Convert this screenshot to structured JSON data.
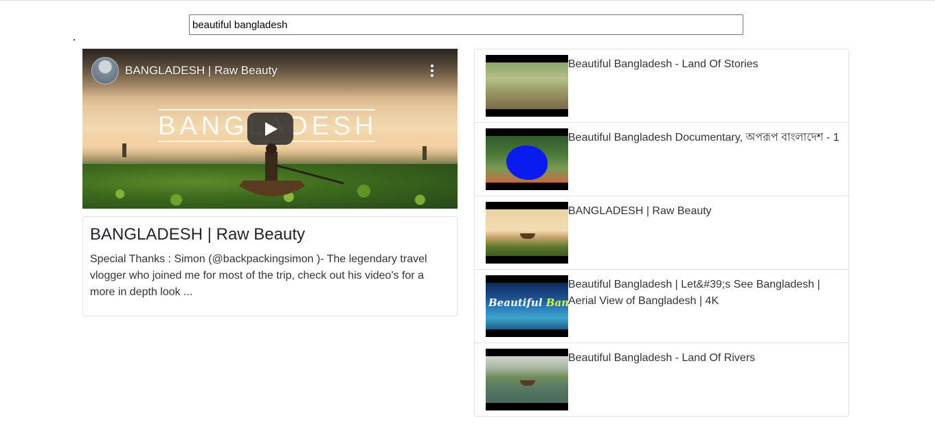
{
  "search": {
    "value": "beautiful bangladesh"
  },
  "player": {
    "channel_title": "BANGLADESH | Raw Beauty",
    "overlay_word": "BANGLADESH"
  },
  "description": {
    "title": "BANGLADESH | Raw Beauty",
    "text": "Special Thanks : Simon (@backpackingsimon )- The legendary travel vlogger who joined me for most of the trip, check out his video's for a more in depth look ..."
  },
  "results": [
    {
      "title": "Beautiful Bangladesh - Land Of Stories"
    },
    {
      "title": "Beautiful Bangladesh Documentary, অপরূপ বাংলাদেশ - 1"
    },
    {
      "title": "BANGLADESH | Raw Beauty"
    },
    {
      "title": "Beautiful Bangladesh | Let&#39;s See Bangladesh | Aerial View of Bangladesh | 4K",
      "thumb_text_main": "Beautiful",
      "thumb_text_accent": "Bangladesh"
    },
    {
      "title": "Beautiful Bangladesh - Land Of Rivers"
    }
  ],
  "colors": {
    "play_button": "#212121",
    "card_border": "#dee2e6"
  }
}
